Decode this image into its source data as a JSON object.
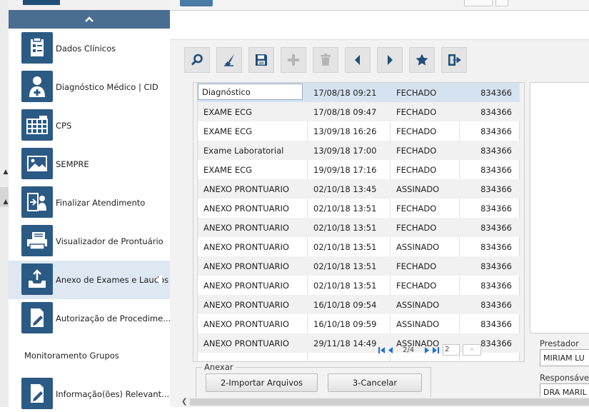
{
  "colors": {
    "sidebar_accent": "#4a6e92",
    "icon_bg": "#2b5a84",
    "selected_row": "#d5e3f1",
    "active_item": "#dde8f3",
    "pager_blue": "#1f6fd0"
  },
  "sidebar": {
    "collapse_icon": "chevron-up-icon",
    "items": [
      {
        "label": "Dados Clínicos",
        "icon": "clipboard-icon"
      },
      {
        "label": "Diagnóstico Médico | CID",
        "icon": "doctor-icon"
      },
      {
        "label": "CPS",
        "icon": "grid-icon"
      },
      {
        "label": "SEMPRE",
        "icon": "image-icon"
      },
      {
        "label": "Finalizar Atendimento",
        "icon": "exit-user-icon"
      },
      {
        "label": "Visualizador de Prontuário",
        "icon": "printer-icon"
      },
      {
        "label": "Anexo de Exames e Laudos",
        "icon": "tray-upload-icon"
      },
      {
        "label": "Autorização de Procedime...",
        "icon": "document-pen-icon"
      }
    ],
    "section_label": "Monitoramento Grupos",
    "bottom_item": {
      "label": "Informação(ões) Relevant...",
      "icon": "document-pen-icon"
    }
  },
  "toolbar": {
    "buttons": [
      {
        "icon": "search-icon",
        "enabled": true
      },
      {
        "icon": "brush-icon",
        "enabled": true
      },
      {
        "icon": "save-icon",
        "enabled": true
      },
      {
        "icon": "plus-icon",
        "enabled": false
      },
      {
        "icon": "trash-icon",
        "enabled": false
      },
      {
        "icon": "arrow-left-icon",
        "enabled": true
      },
      {
        "icon": "arrow-right-icon",
        "enabled": true
      },
      {
        "icon": "star-icon",
        "enabled": true
      },
      {
        "icon": "exit-icon",
        "enabled": true
      }
    ]
  },
  "grid": {
    "rows": [
      {
        "tipo": "Diagnóstico",
        "data": "17/08/18 09:21",
        "status": "FECHADO",
        "codigo": "834366"
      },
      {
        "tipo": "EXAME ECG",
        "data": "17/08/18 09:47",
        "status": "FECHADO",
        "codigo": "834366"
      },
      {
        "tipo": "EXAME ECG",
        "data": "13/09/18 16:26",
        "status": "FECHADO",
        "codigo": "834366"
      },
      {
        "tipo": "Exame Laboratorial",
        "data": "13/09/18 17:00",
        "status": "FECHADO",
        "codigo": "834366"
      },
      {
        "tipo": "EXAME ECG",
        "data": "19/09/18 17:16",
        "status": "FECHADO",
        "codigo": "834366"
      },
      {
        "tipo": "ANEXO PRONTUARIO",
        "data": "02/10/18 13:45",
        "status": "ASSINADO",
        "codigo": "834366"
      },
      {
        "tipo": "ANEXO PRONTUARIO",
        "data": "02/10/18 13:51",
        "status": "FECHADO",
        "codigo": "834366"
      },
      {
        "tipo": "ANEXO PRONTUARIO",
        "data": "02/10/18 13:51",
        "status": "FECHADO",
        "codigo": "834366"
      },
      {
        "tipo": "ANEXO PRONTUARIO",
        "data": "02/10/18 13:51",
        "status": "ASSINADO",
        "codigo": "834366"
      },
      {
        "tipo": "ANEXO PRONTUARIO",
        "data": "02/10/18 13:51",
        "status": "FECHADO",
        "codigo": "834366"
      },
      {
        "tipo": "ANEXO PRONTUARIO",
        "data": "02/10/18 13:51",
        "status": "FECHADO",
        "codigo": "834366"
      },
      {
        "tipo": "ANEXO PRONTUARIO",
        "data": "16/10/18 09:54",
        "status": "ASSINADO",
        "codigo": "834366"
      },
      {
        "tipo": "ANEXO PRONTUARIO",
        "data": "16/10/18 09:59",
        "status": "ASSINADO",
        "codigo": "834366"
      },
      {
        "tipo": "ANEXO PRONTUARIO",
        "data": "29/11/18 14:49",
        "status": "ASSINADO",
        "codigo": "834366"
      }
    ],
    "selected_row": 0
  },
  "pager": {
    "page_info": "2/4",
    "page_input": "2",
    "page_size": "-"
  },
  "anexar": {
    "legend": "Anexar",
    "import_button": "2-Importar Arquivos",
    "cancel_button": "3-Cancelar"
  },
  "right_panel": {
    "prestador_label": "Prestador",
    "prestador_value": "MIRIAM LU",
    "responsavel_label": "Responsável",
    "responsavel_value": "DRA MARIL"
  }
}
